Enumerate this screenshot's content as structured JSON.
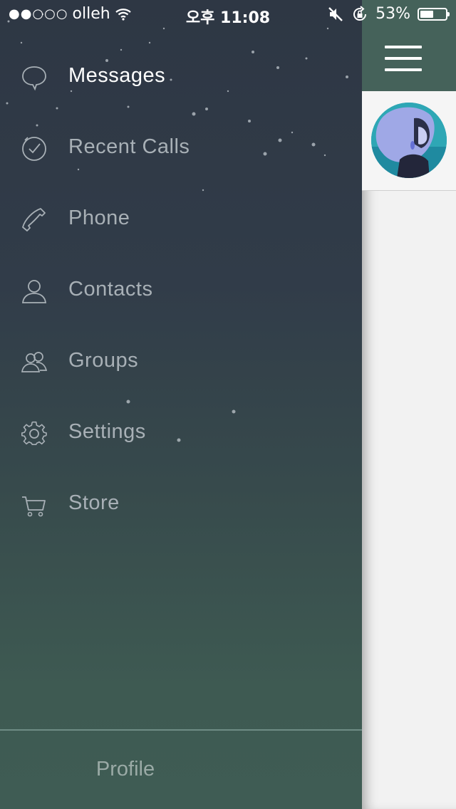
{
  "status_bar": {
    "signal": "●●○○○",
    "carrier": "olleh",
    "time": "오후 11:08",
    "battery": "53%",
    "battery_level": 0.53
  },
  "menu": {
    "items": [
      {
        "label": "Messages",
        "icon": "speech-bubble-icon",
        "active": true
      },
      {
        "label": "Recent Calls",
        "icon": "clock-icon",
        "active": false
      },
      {
        "label": "Phone",
        "icon": "phone-icon",
        "active": false
      },
      {
        "label": "Contacts",
        "icon": "person-icon",
        "active": false
      },
      {
        "label": "Groups",
        "icon": "group-icon",
        "active": false
      },
      {
        "label": "Settings",
        "icon": "gear-icon",
        "active": false
      },
      {
        "label": "Store",
        "icon": "cart-icon",
        "active": false
      }
    ]
  },
  "profile": {
    "label": "Profile"
  },
  "colors": {
    "drawer_top": "#2e3744",
    "drawer_bottom": "#3f5c54",
    "header": "#45625a",
    "active_text": "#ffffff",
    "inactive_text": "#a8b0b6"
  }
}
